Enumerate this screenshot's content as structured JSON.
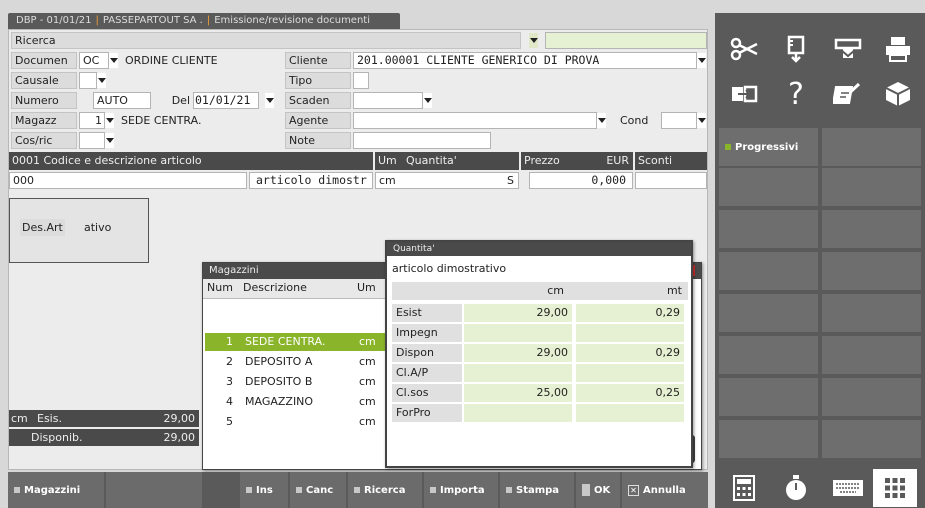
{
  "title": {
    "code": "DBP - 01/01/21",
    "company": "PASSEPARTOUT SA .",
    "window": "Emissione/revisione documenti"
  },
  "form": {
    "ricerca_label": "Ricerca",
    "documen_label": "Documen",
    "documen_code": "OC",
    "documen_desc": "ORDINE CLIENTE",
    "causale_label": "Causale",
    "numero_label": "Numero",
    "numero_value": "AUTO",
    "del_label": "Del",
    "del_value": "01/01/21",
    "magazz_label": "Magazz",
    "magazz_value": "1",
    "magazz_desc": "SEDE CENTRA.",
    "cosric_label": "Cos/ric",
    "cliente_label": "Cliente",
    "cliente_value": "201.00001 CLIENTE GENERICO DI PROVA",
    "tipo_label": "Tipo",
    "scaden_label": "Scaden",
    "agente_label": "Agente",
    "note_label": "Note",
    "cond_label": "Cond"
  },
  "grid": {
    "h_code": "0001  Codice e descrizione articolo",
    "h_um": "Um",
    "h_qta": "Quantita'",
    "h_prezzo": "Prezzo",
    "h_eur": "EUR",
    "h_sconti": "Sconti",
    "code": "000",
    "desc": "articolo dimostr",
    "um": "cm",
    "flag": "S",
    "prezzo": "0,000"
  },
  "desart": {
    "label": "Des.Art",
    "value": "ativo"
  },
  "summary": {
    "um": "cm",
    "esis_label": "Esis.",
    "esis_value": "29,00",
    "disp_label": "Disponib.",
    "disp_value": "29,00"
  },
  "magazzini": {
    "title": "Magazzini",
    "h_num": "Num",
    "h_desc": "Descrizione",
    "h_um": "Um",
    "rows": [
      {
        "num": "1",
        "desc": "SEDE CENTRA.",
        "um": "cm"
      },
      {
        "num": "2",
        "desc": "DEPOSITO A",
        "um": "cm"
      },
      {
        "num": "3",
        "desc": "DEPOSITO B",
        "um": "cm"
      },
      {
        "num": "4",
        "desc": "MAGAZZINO",
        "um": "cm"
      },
      {
        "num": "5",
        "desc": "",
        "um": "cm"
      }
    ]
  },
  "quantita": {
    "title": "Quantita'",
    "article": "articolo dimostrativo",
    "col1": "cm",
    "col2": "mt",
    "rows": [
      {
        "label": "Esist",
        "v1": "29,00",
        "v2": "0,29"
      },
      {
        "label": "Impegn",
        "v1": "",
        "v2": ""
      },
      {
        "label": "Dispon",
        "v1": "29,00",
        "v2": "0,29"
      },
      {
        "label": "Cl.A/P",
        "v1": "",
        "v2": ""
      },
      {
        "label": "Cl.sos",
        "v1": "25,00",
        "v2": "0,25"
      },
      {
        "label": "ForPro",
        "v1": "",
        "v2": ""
      }
    ]
  },
  "side": {
    "progressivi": "Progressivi"
  },
  "bottom": {
    "magazzini": "Magazzini",
    "ins": "Ins",
    "canc": "Canc",
    "ricerca": "Ricerca",
    "importa": "Importa",
    "stampa": "Stampa",
    "ok": "OK",
    "annulla": "Annulla"
  },
  "colors": {
    "accent": "#8ab42a",
    "orange": "#f0a030",
    "panel": "#5a5a5a",
    "close": "#d03030"
  }
}
